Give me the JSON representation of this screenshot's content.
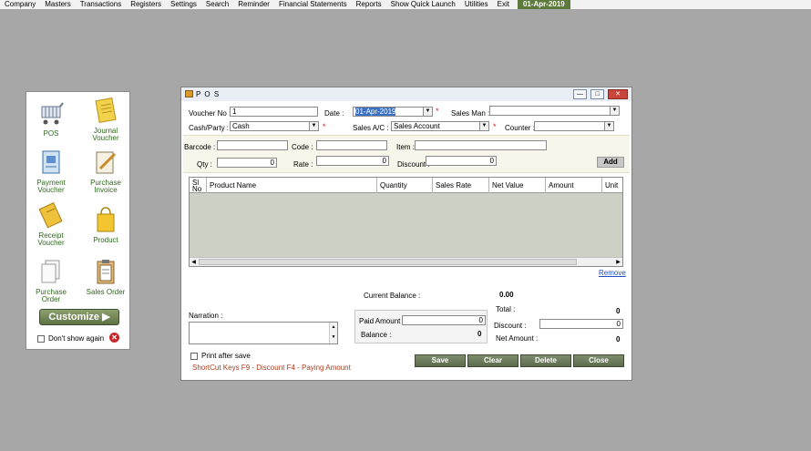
{
  "menubar": {
    "items": [
      "Company",
      "Masters",
      "Transactions",
      "Registers",
      "Settings",
      "Search",
      "Reminder",
      "Financial Statements",
      "Reports",
      "Show Quick Launch",
      "Utilities",
      "Exit"
    ],
    "date": "01-Apr-2019"
  },
  "quick_launch": {
    "tiles": [
      {
        "label": "POS",
        "icon": "cart-icon"
      },
      {
        "label": "Journal Voucher",
        "icon": "notepad-icon"
      },
      {
        "label": "Payment Voucher",
        "icon": "payment-doc-icon"
      },
      {
        "label": "Purchase Invoice",
        "icon": "pencil-paper-icon"
      },
      {
        "label": "Receipt Voucher",
        "icon": "receipt-icon"
      },
      {
        "label": "Product",
        "icon": "shopping-bag-icon"
      },
      {
        "label": "Purchase Order",
        "icon": "documents-icon"
      },
      {
        "label": "Sales Order",
        "icon": "clipboard-icon"
      }
    ],
    "customize_label": "Customize",
    "dont_show_label": "Don't show again"
  },
  "pos": {
    "title": "P O S",
    "voucher_no_label": "Voucher No :",
    "voucher_no": "1",
    "date_label": "Date :",
    "date_value": "01-Apr-2019",
    "sales_man_label": "Sales Man :",
    "sales_man_value": "",
    "cash_party_label": "Cash/Party :",
    "cash_party_value": "Cash",
    "sales_ac_label": "Sales A/C :",
    "sales_ac_value": "Sales Account",
    "counter_label": "Counter :",
    "counter_value": "",
    "barcode_label": "Barcode :",
    "code_label": "Code :",
    "item_label": "Item :",
    "qty_label": "Qty :",
    "qty_value": "0",
    "rate_label": "Rate :",
    "rate_value": "0",
    "discount_label": "Discount :",
    "discount_value": "0",
    "add_label": "Add",
    "grid_columns": [
      "Sl No",
      "Product Name",
      "Quantity",
      "Sales Rate",
      "Net Value",
      "Amount",
      "Unit"
    ],
    "remove_label": "Remove",
    "narration_label": "Narration :",
    "current_balance_label": "Current Balance :",
    "current_balance_value": "0.00",
    "total_label": "Total :",
    "total_value": "0",
    "paid_amount_label": "Paid Amount :",
    "paid_amount_value": "0",
    "balance_label": "Balance :",
    "balance_value": "0",
    "bottom_discount_label": "Discount :",
    "bottom_discount_value": "0",
    "net_amount_label": "Net Amount :",
    "net_amount_value": "0",
    "print_after_save_label": "Print after save",
    "shortcut_text": "ShortCut Keys  F9 - Discount   F4 - Paying Amount",
    "buttons": {
      "save": "Save",
      "clear": "Clear",
      "delete": "Delete",
      "close": "Close"
    }
  }
}
